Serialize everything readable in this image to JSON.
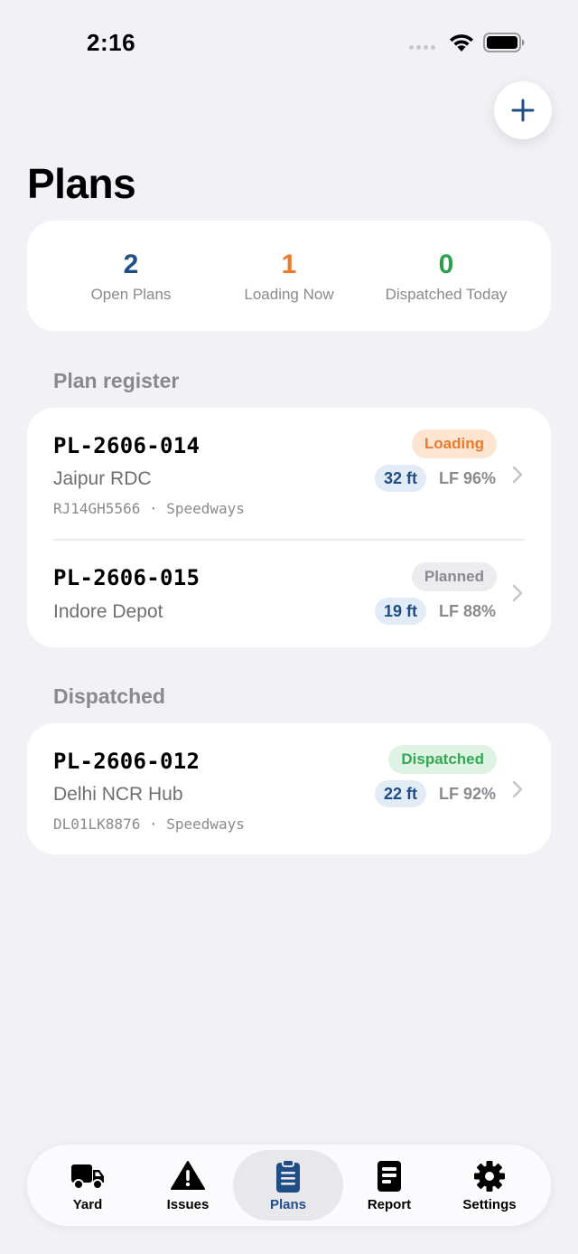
{
  "status_bar": {
    "time": "2:16"
  },
  "header": {
    "title": "Plans",
    "add_icon": "plus-icon"
  },
  "stats": [
    {
      "value": "2",
      "label": "Open Plans",
      "color": "#1f4e87"
    },
    {
      "value": "1",
      "label": "Loading Now",
      "color": "#ea7a2c"
    },
    {
      "value": "0",
      "label": "Dispatched Today",
      "color": "#2e9e4f"
    }
  ],
  "sections": {
    "register": {
      "title": "Plan register",
      "plans": [
        {
          "id": "PL-2606-014",
          "destination": "Jaipur RDC",
          "meta": "RJ14GH5566 · Speedways",
          "status": "Loading",
          "size": "32 ft",
          "lf": "LF 96%"
        },
        {
          "id": "PL-2606-015",
          "destination": "Indore Depot",
          "meta": "",
          "status": "Planned",
          "size": "19 ft",
          "lf": "LF 88%"
        }
      ]
    },
    "dispatched": {
      "title": "Dispatched",
      "plans": [
        {
          "id": "PL-2606-012",
          "destination": "Delhi NCR Hub",
          "meta": "DL01LK8876 · Speedways",
          "status": "Dispatched",
          "size": "22 ft",
          "lf": "LF 92%"
        }
      ]
    }
  },
  "tab_bar": {
    "active": "Plans",
    "tabs": [
      {
        "label": "Yard",
        "icon": "truck-icon"
      },
      {
        "label": "Issues",
        "icon": "warning-icon"
      },
      {
        "label": "Plans",
        "icon": "clipboard-icon"
      },
      {
        "label": "Report",
        "icon": "report-icon"
      },
      {
        "label": "Settings",
        "icon": "gear-icon"
      }
    ]
  }
}
